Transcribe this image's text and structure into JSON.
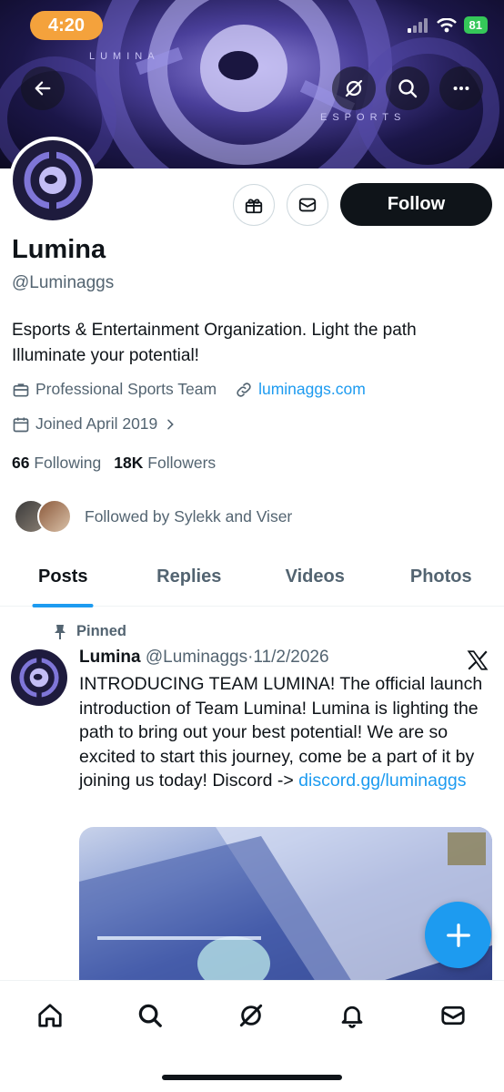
{
  "status": {
    "time": "4:20",
    "battery": "81"
  },
  "banner": {
    "brand_top": "LUMINA",
    "brand_bottom": "ESPORTS"
  },
  "header_icons": [
    "back-arrow-icon",
    "grok-icon",
    "search-icon",
    "more-icon"
  ],
  "profile": {
    "name": "Lumina",
    "handle": "@Luminaggs",
    "bio": "Esports & Entertainment Organization. Light the path Illuminate your potential!",
    "category": "Professional Sports Team",
    "website": "luminaggs.com",
    "joined": "Joined April 2019",
    "following_count": "66",
    "following_label": "Following",
    "followers_count": "18K",
    "followers_label": "Followers",
    "followed_by": "Followed by Sylekk and Viser",
    "follow_button": "Follow"
  },
  "tabs": [
    {
      "label": "Posts",
      "active": true
    },
    {
      "label": "Replies",
      "active": false
    },
    {
      "label": "Videos",
      "active": false
    },
    {
      "label": "Photos",
      "active": false
    }
  ],
  "post": {
    "pinned_label": "Pinned",
    "author": "Lumina",
    "handle": "@Luminaggs",
    "separator": "·",
    "date": "11/2/2026",
    "text": "INTRODUCING TEAM LUMINA!  The official launch introduction of Team Lumina! Lumina is lighting the path to bring out your best potential! We are so excited to start this journey, come be a part of it by joining us today! Discord -> ",
    "link": "discord.gg/luminaggs"
  },
  "bottom_nav": [
    "home-icon",
    "search-icon",
    "grok-icon",
    "notifications-icon",
    "messages-icon"
  ],
  "colors": {
    "accent": "#1d9bf0",
    "text": "#0f1419",
    "secondary": "#536471",
    "status_pill": "#f4a23c"
  }
}
